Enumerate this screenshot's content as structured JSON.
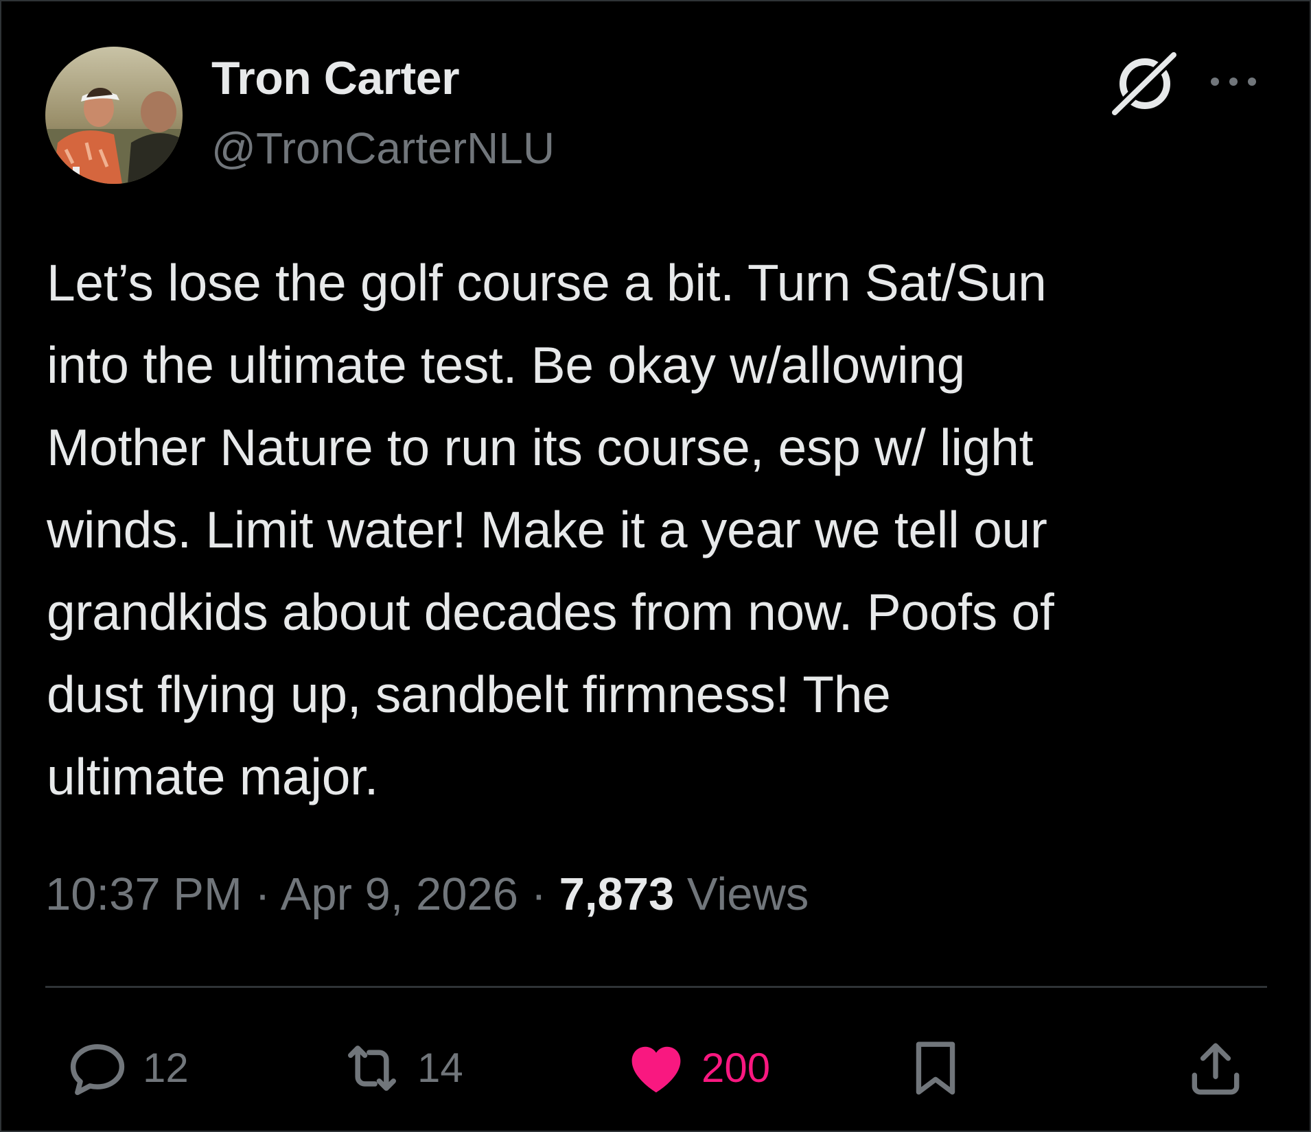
{
  "tweet": {
    "author": {
      "display_name": "Tron Carter",
      "handle": "@TronCarterNLU",
      "avatar_icon": "golfer-profile-photo"
    },
    "header_icons": [
      "grok-icon",
      "more-icon"
    ],
    "text": "Let’s lose the golf course a bit. Turn Sat/Sun\ninto the ultimate test. Be okay w/allowing\nMother Nature to run its course, esp w/ light\nwinds. Limit water! Make it a year we tell our\ngrandkids about decades from now. Poofs of\ndust flying up, sandbelt firmness! The\nultimate major.",
    "time": "10:37 PM",
    "separator": "·",
    "date": "Apr 9, 2026",
    "views_count": "7,873",
    "views_label": "Views"
  },
  "actions": {
    "reply": {
      "icon": "reply-icon",
      "count": "12"
    },
    "retweet": {
      "icon": "retweet-icon",
      "count": "14"
    },
    "like": {
      "icon": "heart-icon",
      "count": "200",
      "liked": true
    },
    "bookmark": {
      "icon": "bookmark-icon"
    },
    "share": {
      "icon": "share-icon"
    }
  },
  "colors": {
    "background": "#000000",
    "primary_text": "#e7e9ea",
    "secondary_text": "#71767b",
    "divider": "#2f3336",
    "like_pink": "#f91880"
  }
}
